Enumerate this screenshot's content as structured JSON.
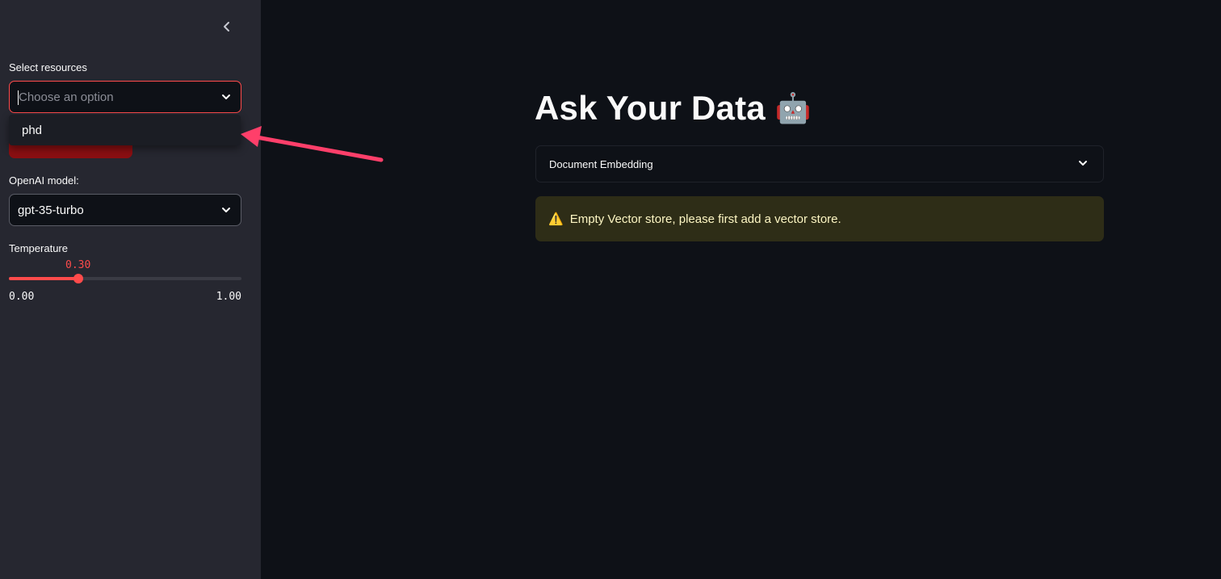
{
  "sidebar": {
    "resources": {
      "label": "Select resources",
      "placeholder": "Choose an option",
      "options": [
        "phd"
      ]
    },
    "model": {
      "label": "OpenAI model:",
      "value": "gpt-35-turbo"
    },
    "temperature": {
      "label": "Temperature",
      "value": "0.30",
      "fraction": 0.3,
      "min": "0.00",
      "max": "1.00"
    }
  },
  "main": {
    "title": "Ask Your Data",
    "title_emoji": "🤖",
    "expander_label": "Document Embedding",
    "warning_icon": "⚠️",
    "warning_text": "Empty Vector store, please first add a vector store."
  },
  "colors": {
    "accent": "#ff4b4b",
    "annotation_arrow": "#ff3f6a",
    "background": "#0e1117",
    "sidebar": "#262730"
  },
  "icons": {
    "collapse": "chevron-left-icon",
    "select": "chevron-down-icon",
    "warning": "warning-icon",
    "annotation": "arrow-annotation"
  }
}
